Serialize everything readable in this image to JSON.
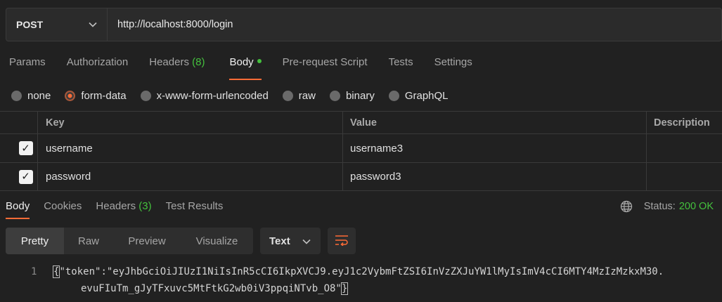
{
  "request": {
    "method": "POST",
    "url": "http://localhost:8000/login"
  },
  "request_tabs": [
    {
      "label": "Params"
    },
    {
      "label": "Authorization"
    },
    {
      "label": "Headers",
      "count": "(8)"
    },
    {
      "label": "Body"
    },
    {
      "label": "Pre-request Script"
    },
    {
      "label": "Tests"
    },
    {
      "label": "Settings"
    }
  ],
  "body_types": [
    "none",
    "form-data",
    "x-www-form-urlencoded",
    "raw",
    "binary",
    "GraphQL"
  ],
  "body_type_selected": "form-data",
  "params_table": {
    "headers": [
      "Key",
      "Value",
      "Description"
    ],
    "rows": [
      {
        "checked": true,
        "key": "username",
        "value": "username3",
        "description": ""
      },
      {
        "checked": true,
        "key": "password",
        "value": "password3",
        "description": ""
      }
    ]
  },
  "response": {
    "tabs": [
      {
        "label": "Body"
      },
      {
        "label": "Cookies"
      },
      {
        "label": "Headers",
        "count": "(3)"
      },
      {
        "label": "Test Results"
      }
    ],
    "status_label": "Status:",
    "status_value": "200 OK",
    "view_modes": [
      "Pretty",
      "Raw",
      "Preview",
      "Visualize"
    ],
    "format": "Text",
    "line_number": "1",
    "body_line1": "\"token\":\"eyJhbGciOiJIUzI1NiIsInR5cCI6IkpXVCJ9.eyJ1c2VybmFtZSI6InVzZXJuYW1lMyIsImV4cCI6MTY4MzIzMzkxM30.",
    "body_line2": "evuFIuTm_gJyTFxuvc5MtFtkG2wb0iV3ppqiNTvb_O8\"",
    "open_brace": "{",
    "close_brace": "}"
  },
  "colors": {
    "accent": "#ff6c37",
    "success": "#44c13d",
    "background": "#212121"
  },
  "icons": [
    "chevron-down-icon",
    "checkbox-icon",
    "globe-icon",
    "wrap-lines-icon"
  ]
}
